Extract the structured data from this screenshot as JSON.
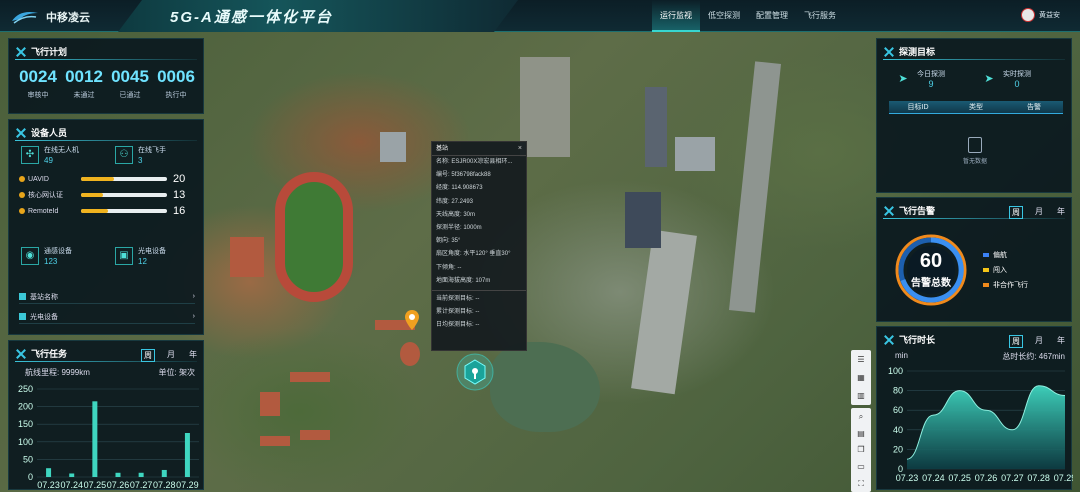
{
  "header": {
    "brand": "中移凌云",
    "title": "5G-A通感一体化平台",
    "tabs": [
      {
        "label": "运行监视",
        "active": true
      },
      {
        "label": "低空探测",
        "active": false
      },
      {
        "label": "配置管理",
        "active": false
      },
      {
        "label": "飞行服务",
        "active": false
      }
    ],
    "user_name": "黄益安"
  },
  "flight_plan": {
    "title": "飞行计划",
    "items": [
      {
        "value": "0024",
        "label": "审核中"
      },
      {
        "value": "0012",
        "label": "未通过"
      },
      {
        "value": "0045",
        "label": "已通过"
      },
      {
        "value": "0006",
        "label": "执行中"
      }
    ]
  },
  "devices": {
    "title": "设备人员",
    "online_uav_label": "在线无人机",
    "online_uav_value": "49",
    "online_pilot_label": "在线飞手",
    "online_pilot_value": "3",
    "bars": [
      {
        "label": "UAVID",
        "value": 20,
        "fill": 0.38
      },
      {
        "label": "核心网认证",
        "value": 13,
        "fill": 0.25
      },
      {
        "label": "RemoteId",
        "value": 16,
        "fill": 0.31
      }
    ],
    "comm_label": "通感设备",
    "comm_value": "123",
    "photo_label": "光电设备",
    "photo_value": "12",
    "links": [
      {
        "label": "基站名称"
      },
      {
        "label": "光电设备"
      }
    ],
    "icons": {
      "uav": "drone-icon",
      "pilot": "pilot-icon",
      "comm": "antenna-icon",
      "photo": "camera-icon"
    }
  },
  "flight_task": {
    "title": "飞行任务",
    "seg": [
      "周",
      "月",
      "年"
    ],
    "mileage_label": "航线里程: 9999km",
    "unit_label": "单位: 架次"
  },
  "targets": {
    "title": "探测目标",
    "today_label": "今日探测",
    "today_value": "9",
    "realtime_label": "实时探测",
    "realtime_value": "0",
    "columns": [
      "目标ID",
      "类型",
      "告警"
    ],
    "empty": "暂无数据"
  },
  "alarm": {
    "title": "飞行告警",
    "seg": [
      "周",
      "月",
      "年"
    ],
    "total": "60",
    "total_label": "告警总数",
    "legend": [
      {
        "label": "偏航",
        "color": "#3b82f6"
      },
      {
        "label": "闯入",
        "color": "#f5c518"
      },
      {
        "label": "非合作飞行",
        "color": "#f08a1c"
      }
    ]
  },
  "duration": {
    "title": "飞行时长",
    "seg": [
      "周",
      "月",
      "年"
    ],
    "unit": "min",
    "total_label": "总时长约: 467min"
  },
  "popup": {
    "title": "基站",
    "rows": [
      "名称: ESJR00X凉宏县相环...",
      "编号: 5f36798fack88",
      "经度: 114.908673",
      "纬度: 27.2493",
      "天线高度: 30m",
      "探测半径: 1000m",
      "朝向: 35°",
      "扇区角度: 水平120° 垂直30°",
      "下倾角: --",
      "地面海拔高度: 107m"
    ],
    "rows2": [
      "当前探测目标: --",
      "累计探测目标: --",
      "日均探测目标: --"
    ]
  },
  "chart_data": [
    {
      "type": "bar",
      "categories": [
        "07.23",
        "07.24",
        "07.25",
        "07.26",
        "07.27",
        "07.28",
        "07.29"
      ],
      "values": [
        25,
        10,
        215,
        12,
        12,
        20,
        125
      ],
      "ylim": [
        0,
        250
      ],
      "yticks": [
        0,
        50,
        100,
        150,
        200,
        250
      ],
      "color": "#3fd6c0"
    },
    {
      "type": "area",
      "x": [
        "07.23",
        "07.24",
        "07.25",
        "07.26",
        "07.27",
        "07.28",
        "07.29"
      ],
      "values": [
        10,
        55,
        80,
        60,
        40,
        85,
        75
      ],
      "ylim": [
        0,
        100
      ],
      "yticks": [
        0,
        20,
        40,
        60,
        80,
        100
      ],
      "color": "#3fd6c0"
    }
  ]
}
